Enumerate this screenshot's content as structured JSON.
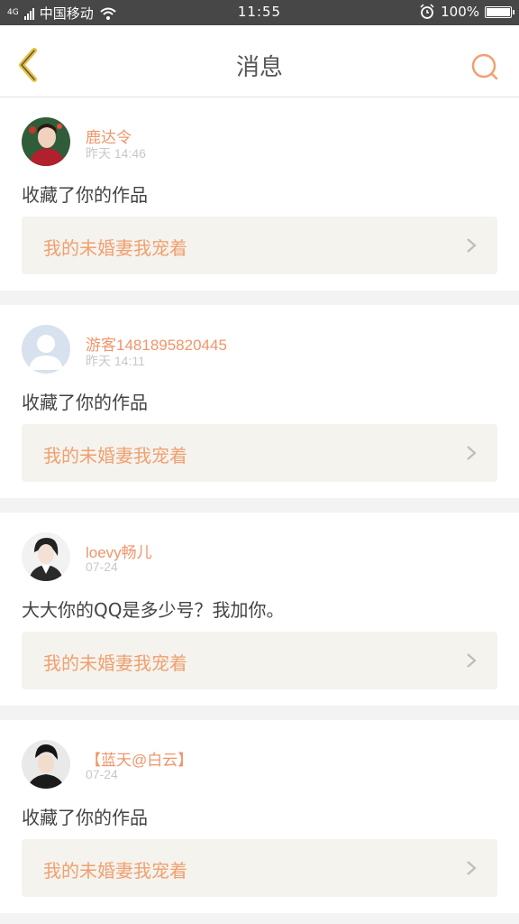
{
  "statusbar": {
    "network": "4G",
    "carrier": "中国移动",
    "time": "11:55",
    "battery_text": "100%",
    "battery_level": 1.0,
    "icons": [
      "signal-icon",
      "wifi-icon",
      "alarm-icon",
      "battery-icon"
    ]
  },
  "header": {
    "title": "消息",
    "back_icon": "back-chevron-icon",
    "search_icon": "search-icon",
    "accent_color": "#f0a070",
    "back_color": "#e8c23a"
  },
  "messages": [
    {
      "user": "鹿达令",
      "time": "昨天 14:46",
      "content": "收藏了你的作品",
      "work": "我的未婚妻我宠着",
      "avatar": "avatar-red"
    },
    {
      "user": "游客1481895820445",
      "time": "昨天 14:11",
      "content": "收藏了你的作品",
      "work": "我的未婚妻我宠着",
      "avatar": "avatar-default"
    },
    {
      "user": "loevy畅儿",
      "time": "07-24",
      "content": "大大你的QQ是多少号？我加你。",
      "work": "我的未婚妻我宠着",
      "avatar": "avatar-white"
    },
    {
      "user": "【蓝天@白云】",
      "time": "07-24",
      "content": "收藏了你的作品",
      "work": "我的未婚妻我宠着",
      "avatar": "avatar-black"
    }
  ]
}
